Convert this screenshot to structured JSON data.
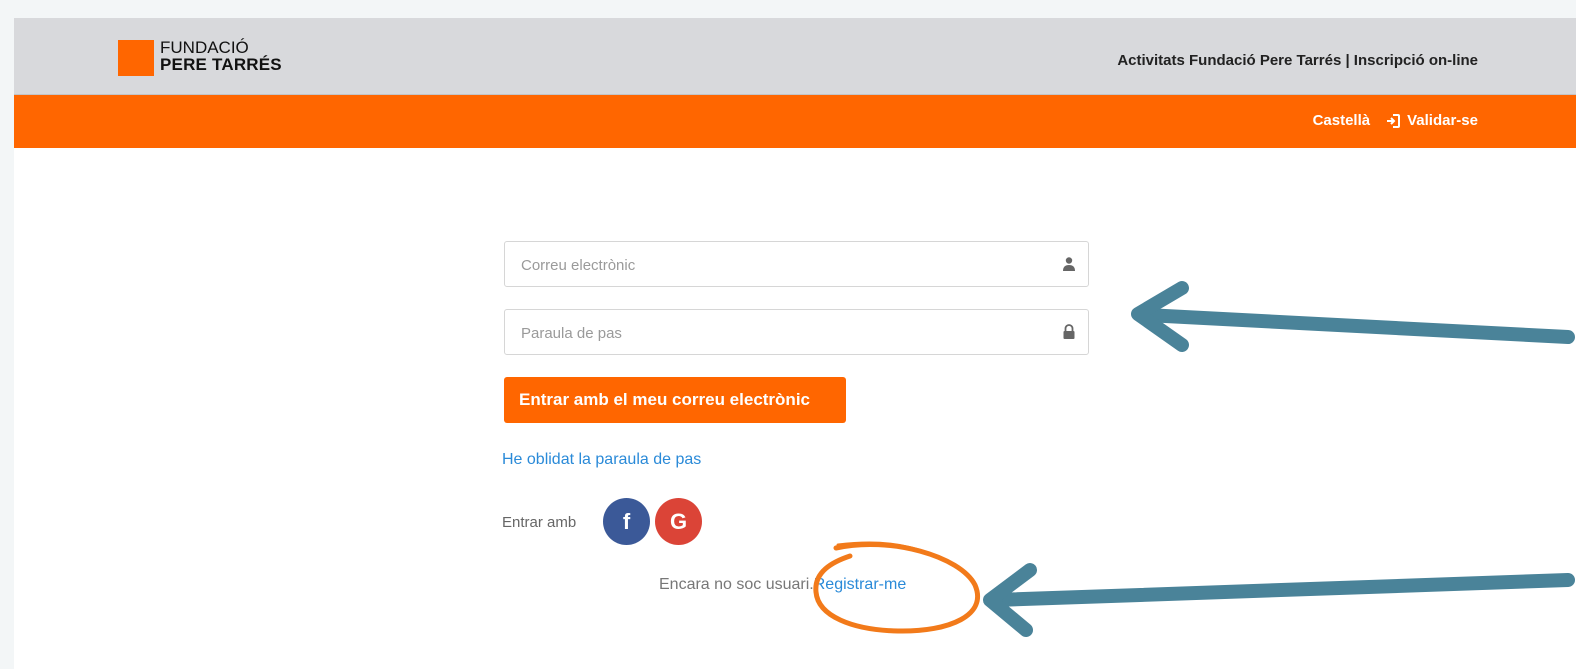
{
  "header": {
    "logo_line1": "FUNDACIÓ",
    "logo_line2": "PERE TARRÉS",
    "site_title": "Activitats Fundació Pere Tarrés | Inscripció on-line"
  },
  "nav": {
    "language": "Castellà",
    "login_label": "Validar-se"
  },
  "form": {
    "email_placeholder": "Correu electrònic",
    "email_value": "",
    "password_placeholder": "Paraula de pas",
    "password_value": "",
    "submit_label": "Entrar amb el meu correu electrònic",
    "forgot_password": "He oblidat la paraula de pas",
    "social_label": "Entrar amb",
    "facebook_glyph": "f",
    "google_glyph": "G",
    "register_prefix": "Encara no soc usuari.",
    "register_link": "Registrar-me"
  },
  "colors": {
    "brand_orange": "#ff6600",
    "link_blue": "#2a8ad8",
    "arrow_teal": "#4a8399",
    "facebook": "#3b5998",
    "google": "#db4437"
  },
  "icons": {
    "email_field": "user-icon",
    "password_field": "lock-icon",
    "login": "sign-in-icon"
  }
}
